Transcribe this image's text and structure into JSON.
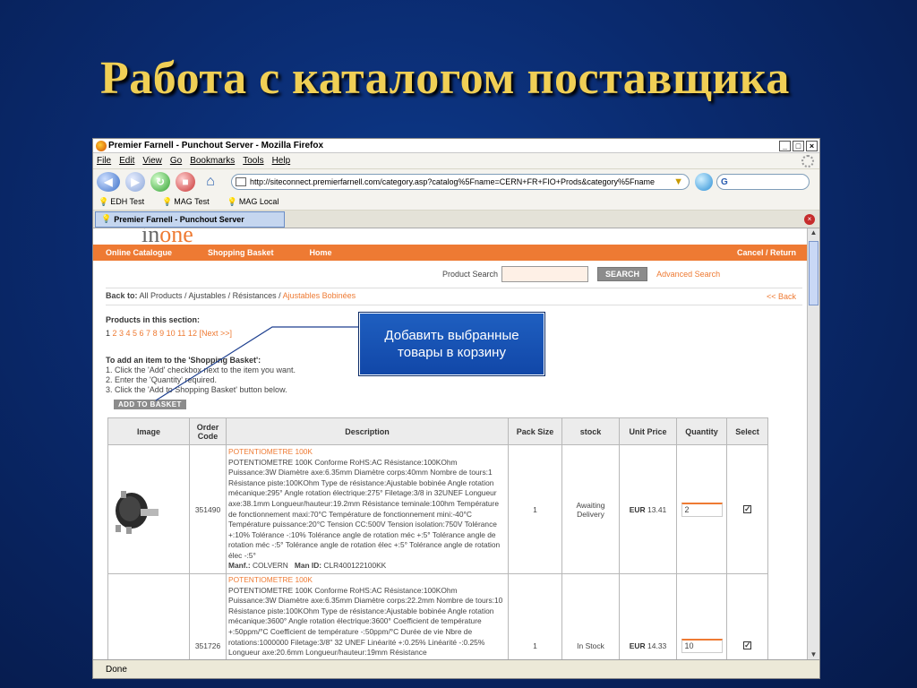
{
  "slide": {
    "title": "Работа с каталогом поставщика"
  },
  "window": {
    "title": "Premier Farnell - Punchout Server - Mozilla Firefox",
    "menu": [
      "File",
      "Edit",
      "View",
      "Go",
      "Bookmarks",
      "Tools",
      "Help"
    ],
    "url": "http://siteconnect.premierfarnell.com/category.asp?catalog%5Fname=CERN+FR+FIO+Prods&category%5Fname",
    "search_engine": "G",
    "bookmarks": [
      "EDH Test",
      "MAG Test",
      "MAG Local"
    ],
    "tab": "Premier Farnell - Punchout Server",
    "status": "Done"
  },
  "site": {
    "logo_in": "in",
    "logo_one": "one",
    "nav": {
      "online": "Online Catalogue",
      "basket": "Shopping Basket",
      "home": "Home",
      "cancel": "Cancel / Return"
    },
    "search": {
      "label": "Product Search",
      "button": "SEARCH",
      "advanced": "Advanced Search"
    },
    "breadcrumb": {
      "label": "Back to:",
      "path": "All Products / Ajustables / Résistances /",
      "current": "Ajustables Bobinées",
      "back": "<< Back"
    },
    "products_heading": "Products in this section:",
    "pages_current": "1",
    "pages_links": "2 3 4 5 6 7 8 9 10 11 12 [Next >>]",
    "instructions": {
      "title": "To add an item to the 'Shopping Basket':",
      "step1": "1. Click the 'Add' checkbox next to the item you want.",
      "step2": "2. Enter the 'Quantity' required.",
      "step3": "3. Click the 'Add to Shopping Basket' button below."
    },
    "add_button": "ADD TO BASKET",
    "callout": "Добавить выбранные товары в корзину",
    "table": {
      "headers": {
        "image": "Image",
        "order_code": "Order Code",
        "description": "Description",
        "pack_size": "Pack Size",
        "stock": "stock",
        "unit_price": "Unit Price",
        "quantity": "Quantity",
        "select": "Select"
      },
      "rows": [
        {
          "code": "351490",
          "name": "POTENTIOMETRE 100K",
          "desc": "POTENTIOMETRE 100K Conforme RoHS:AC Résistance:100KOhm Puissance:3W Diamètre axe:6.35mm Diamètre corps:40mm Nombre de tours:1 Résistance piste:100KOhm Type de résistance:Ajustable bobinée Angle rotation mécanique:295° Angle rotation électrique:275° Filetage:3/8 in 32UNEF Longueur axe:38.1mm Longueur/hauteur:19.2mm Résistance teminale:100hm Température de fonctionnement maxi:70°C Température de fonctionnement mini:-40°C Température puissance:20°C Tension CC:500V Tension isolation:750V Tolérance +:10% Tolérance -:10% Tolérance angle de rotation méc +:5° Tolérance angle de rotation méc -:5° Tolérance angle de rotation élec +:5° Tolérance angle de rotation élec -:5°",
          "manf_label": "Manf.:",
          "manf": "COLVERN",
          "manid_label": "Man ID:",
          "manid": "CLR400122100KK",
          "pack": "1",
          "stock": "Awaiting Delivery",
          "currency": "EUR",
          "price": "13.41",
          "qty": "2",
          "selected": "✓"
        },
        {
          "code": "351726",
          "name": "POTENTIOMETRE 100K",
          "desc": "POTENTIOMETRE 100K Conforme RoHS:AC Résistance:100KOhm Puissance:3W Diamètre axe:6.35mm Diamètre corps:22.2mm Nombre de tours:10 Résistance piste:100KOhm Type de résistance:Ajustable bobinée Angle rotation mécanique:3600° Angle rotation électrique:3600° Coefficient de température +:50ppm/°C Coefficient de température -:50ppm/°C Durée de vie Nbre de rotations:1000000 Filetage:3/8\" 32 UNEF Linéarité +:0.25% Linéarité -:0.25% Longueur axe:20.6mm Longueur/hauteur:19mm Résistance",
          "pack": "1",
          "stock": "In Stock",
          "currency": "EUR",
          "price": "14.33",
          "qty": "10",
          "selected": "✓"
        }
      ]
    }
  }
}
